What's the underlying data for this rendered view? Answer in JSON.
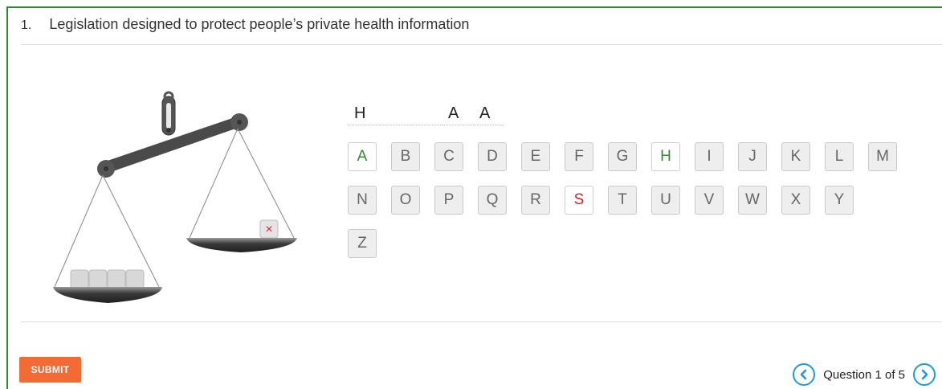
{
  "question": {
    "number": "1.",
    "text": "Legislation designed to protect people’s private health information"
  },
  "answer_slots": [
    "H",
    "",
    "",
    "A",
    "A"
  ],
  "keyboard": {
    "rows": [
      [
        "A",
        "B",
        "C",
        "D",
        "E",
        "F",
        "G",
        "H",
        "I",
        "J",
        "K",
        "L",
        "M"
      ],
      [
        "N",
        "O",
        "P",
        "Q",
        "R",
        "S",
        "T",
        "U",
        "V",
        "W",
        "X",
        "Y"
      ],
      [
        "Z"
      ]
    ],
    "correct": [
      "A",
      "H"
    ],
    "wrong": [
      "S"
    ]
  },
  "scale": {
    "wrong_marker": "×",
    "left_pan_blocks": 4
  },
  "footer": {
    "submit_label": "SUBMIT",
    "pager_label": "Question 1 of 5"
  },
  "colors": {
    "frame": "#2e8b2e",
    "correct": "#2e8b2e",
    "wrong": "#e02020",
    "submit": "#f26a34",
    "nav": "#1f9bd9"
  }
}
